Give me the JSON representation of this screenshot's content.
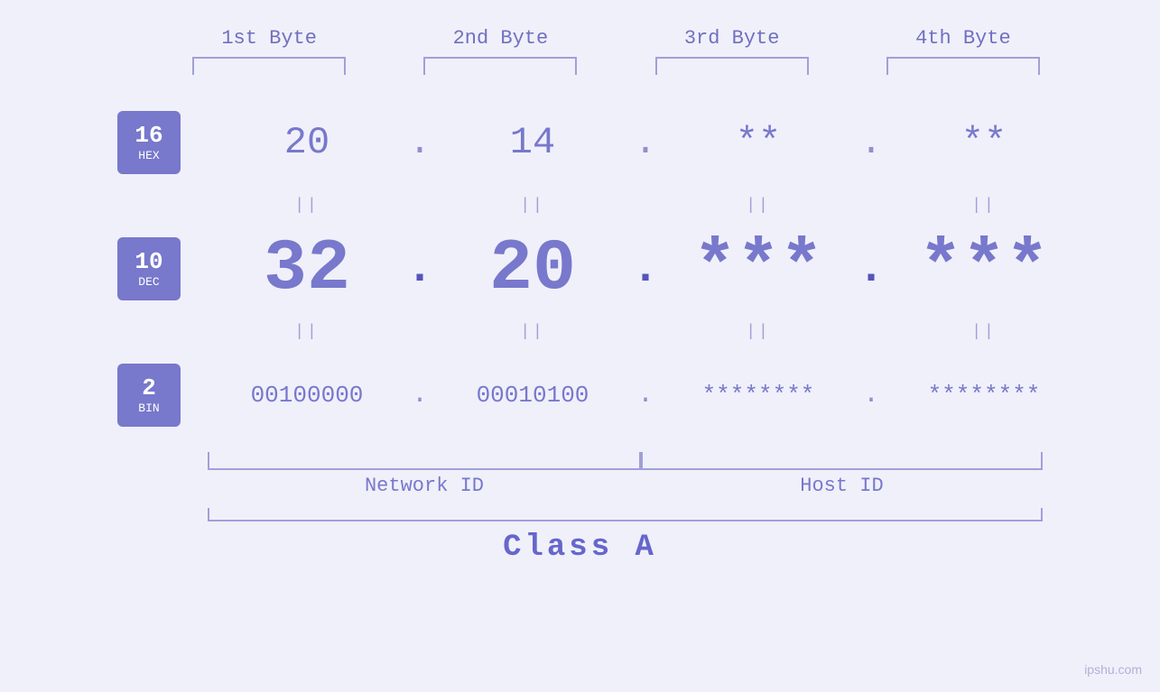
{
  "page": {
    "background": "#f0f0fa",
    "watermark": "ipshu.com"
  },
  "headers": {
    "byte1": "1st Byte",
    "byte2": "2nd Byte",
    "byte3": "3rd Byte",
    "byte4": "4th Byte"
  },
  "badges": [
    {
      "number": "16",
      "label": "HEX"
    },
    {
      "number": "10",
      "label": "DEC"
    },
    {
      "number": "2",
      "label": "BIN"
    }
  ],
  "rows": {
    "hex": {
      "byte1": "20",
      "dot1": ".",
      "byte2": "14",
      "dot2": ".",
      "byte3": "**",
      "dot3": ".",
      "byte4": "**"
    },
    "equals": {
      "sep": "||"
    },
    "dec": {
      "byte1": "32",
      "dot1": ".",
      "byte2": "20",
      "dot2": ".",
      "byte3": "***",
      "dot3": ".",
      "byte4": "***"
    },
    "bin": {
      "byte1": "00100000",
      "dot1": ".",
      "byte2": "00010100",
      "dot2": ".",
      "byte3": "********",
      "dot3": ".",
      "byte4": "********"
    }
  },
  "labels": {
    "network_id": "Network ID",
    "host_id": "Host ID",
    "class": "Class A"
  }
}
